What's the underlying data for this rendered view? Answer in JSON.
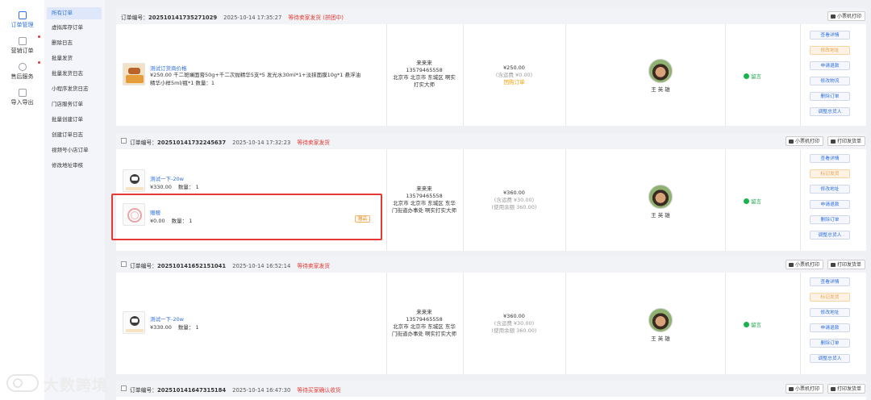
{
  "sidebar": {
    "items": [
      {
        "label": "订单管理",
        "icon": "order-list-icon"
      },
      {
        "label": "营销订单",
        "icon": "marketing-icon"
      },
      {
        "label": "售后服务",
        "icon": "after-sales-icon"
      },
      {
        "label": "导入导出",
        "icon": "import-export-icon"
      }
    ]
  },
  "submenu": {
    "items": [
      "所有订单",
      "虚拟库存订单",
      "删除日志",
      "批量发货",
      "批量发货日志",
      "小程序发货日志",
      "门店服务订单",
      "批量创建订单",
      "创建订单日志",
      "视频号小店订单",
      "修改地址审核"
    ]
  },
  "common": {
    "order_no_label": "订单编号：",
    "print_small": "小票机打印",
    "print_invoice": "打印发货单",
    "qty_label": "数量：",
    "message": "留言",
    "gift": "赠品"
  },
  "orders": [
    {
      "order_no": "202510141735271029",
      "time": "2025-10-14 17:35:27",
      "status": "等待卖家发货 (拼团中)",
      "products": [
        {
          "name": "测试订货商价格",
          "desc": "¥250.00   千二斑斓面膏50g+千二次抛精华5支*5 发光水30ml*1+淡抹面膜10g*1 悬浮油精华小样5ml/瓶*1   数量：1"
        }
      ],
      "address": [
        "来来来",
        "13579465558",
        "北京市 北京市 东城区 啊实",
        "打实大师"
      ],
      "price": {
        "amount": "¥250.00",
        "sub": "(含运费 ¥0.00)",
        "tag": "团购订单"
      },
      "buyer": "王 英 雄",
      "ops": [
        "查看详情",
        "修改地址",
        "申请退款",
        "修改物流",
        "删除订单",
        "调整总货人"
      ]
    },
    {
      "order_no": "202510141732245637",
      "time": "2025-10-14 17:32:23",
      "status": "等待卖家发货",
      "products": [
        {
          "name": "测试一下-20w",
          "price": "¥330.00",
          "qty": "1"
        },
        {
          "name": "赠赠",
          "price": "¥0.00",
          "qty": "1"
        }
      ],
      "address": [
        "来来来",
        "13579465558",
        "北京市 北京市 东城区 东华",
        "门街道办事处 啊实打实大师"
      ],
      "price": {
        "amount": "¥360.00",
        "sub": "(含运费 ¥30.00)",
        "sub2": "(使用余额 360.00)"
      },
      "buyer": "王 英 雄",
      "ops": [
        "查看详情",
        "标记发货",
        "修改地址",
        "申请退款",
        "删除订单",
        "调整总货人"
      ]
    },
    {
      "order_no": "202510141652151041",
      "time": "2025-10-14 16:52:14",
      "status": "等待卖家发货",
      "products": [
        {
          "name": "测试一下-20w",
          "price": "¥330.00",
          "qty": "1"
        }
      ],
      "address": [
        "来来来",
        "13579465558",
        "北京市 北京市 东城区 东华",
        "门街道办事处 啊实打实大师"
      ],
      "price": {
        "amount": "¥360.00",
        "sub": "(含运费 ¥30.00)",
        "sub2": "(使用余额 360.00)"
      },
      "buyer": "王 英 雄",
      "ops": [
        "查看详情",
        "标记发货",
        "修改地址",
        "申请退款",
        "删除订单",
        "调整总货人"
      ]
    },
    {
      "order_no": "202510141647315184",
      "time": "2025-10-14 16:47:30",
      "status": "等待买家确认收货"
    }
  ],
  "watermark": "大数跨境"
}
